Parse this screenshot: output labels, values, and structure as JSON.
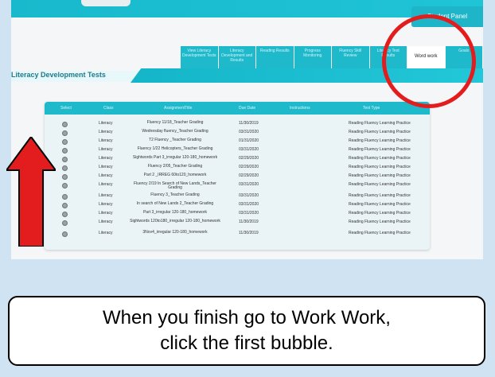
{
  "app": {
    "student_panel": "Student Panel",
    "section_title": "Literacy Development Tests"
  },
  "tabs": [
    {
      "label": "View Literacy Development Tests",
      "active": false
    },
    {
      "label": "Literacy Development and Results",
      "active": false
    },
    {
      "label": "Reading Results",
      "active": false
    },
    {
      "label": "Progress Monitoring",
      "active": false
    },
    {
      "label": "Fluency Skill Review",
      "active": false
    },
    {
      "label": "Literacy Test Results",
      "active": false
    },
    {
      "label": "Word work",
      "active": true
    },
    {
      "label": "Goals",
      "active": false
    }
  ],
  "table": {
    "headers": [
      "Select",
      "Class",
      "AssignmentTitle",
      "Due Date",
      "Instructions",
      "Test Type"
    ],
    "rows": [
      {
        "class": "Literacy",
        "title": "Fluency 11/18_Teacher Grading",
        "due": "11/30/2019",
        "type": "Reading Fluency Learning Practice"
      },
      {
        "class": "Literacy",
        "title": "Wednesday fluency_Teacher Grading",
        "due": "03/31/2020",
        "type": "Reading Fluency Learning Practice"
      },
      {
        "class": "Literacy",
        "title": "T2 Fluency _Teacher Grading",
        "due": "01/31/2020",
        "type": "Reading Fluency Learning Practice"
      },
      {
        "class": "Literacy",
        "title": "Fluency 1/22 Helicopters_Teacher Grading",
        "due": "03/31/2020",
        "type": "Reading Fluency Learning Practice"
      },
      {
        "class": "Literacy",
        "title": "Sightwords Part 3_irregular 120-180_homework",
        "due": "02/29/2020",
        "type": "Reading Fluency Learning Practice"
      },
      {
        "class": "Literacy",
        "title": "Fluency 2/05_Teacher Grading",
        "due": "02/29/2020",
        "type": "Reading Fluency Learning Practice"
      },
      {
        "class": "Literacy",
        "title": "Part 2 _IRREG 60to120_homework",
        "due": "02/29/2020",
        "type": "Reading Fluency Learning Practice"
      },
      {
        "class": "Literacy",
        "title": "Fluency 2/19 In Search of New Lands_Teacher Grading",
        "due": "03/31/2020",
        "type": "Reading Fluency Learning Practice"
      },
      {
        "class": "Literacy",
        "title": "Fluency 3_Teacher Grading",
        "due": "03/31/2020",
        "type": "Reading Fluency Learning Practice"
      },
      {
        "class": "Literacy",
        "title": "In search of New Lands 2_Teacher Grading",
        "due": "03/31/2020",
        "type": "Reading Fluency Learning Practice"
      },
      {
        "class": "Literacy",
        "title": "Part 3_irregular 120-180_homework",
        "due": "03/31/2020",
        "type": "Reading Fluency Learning Practice"
      },
      {
        "class": "Literacy",
        "title": "Sightwords 120to180_irregular 120-180_homework",
        "due": "11/30/2019",
        "type": "Reading Fluency Learning Practice"
      },
      {
        "class": "Literacy",
        "title": "3Nov4_irregular 120-180_homework",
        "due": "11/30/2019",
        "type": "Reading Fluency Learning Practice"
      }
    ]
  },
  "annotation": {
    "caption_line1": "When you finish go to Work Work,",
    "caption_line2": "click the first bubble.",
    "circle_color": "#e31d1d",
    "arrow_color": "#e31d1d"
  }
}
